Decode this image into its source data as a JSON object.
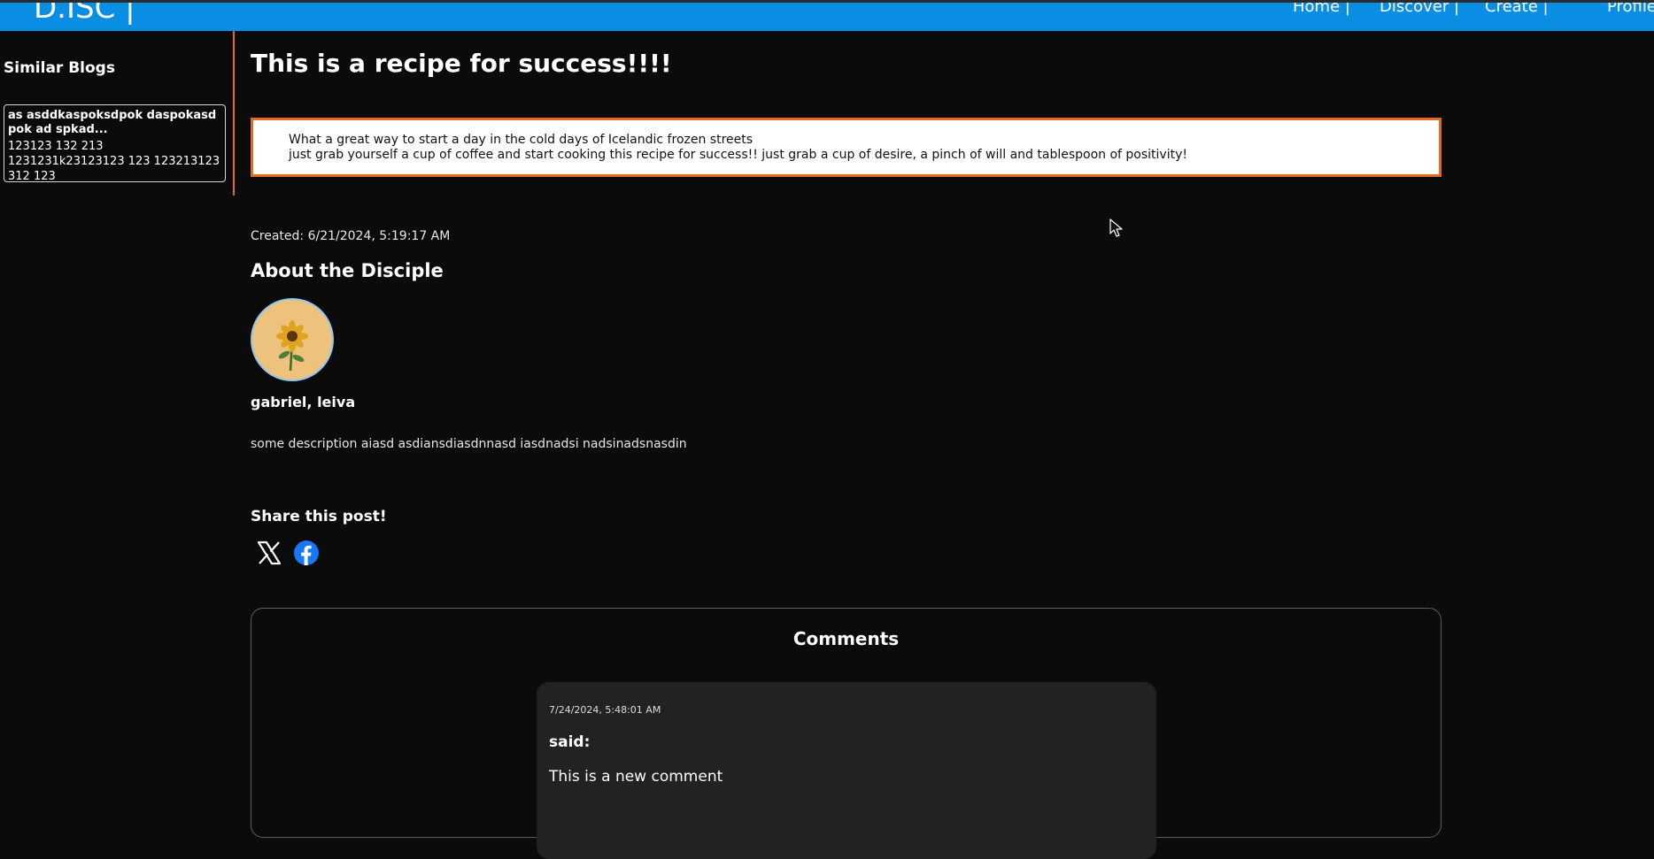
{
  "brand": "D.ISC |",
  "nav": {
    "home": "Home |",
    "discover": "Discover |",
    "create": "Create |",
    "profile": "Profile"
  },
  "sidebar": {
    "title": "Similar Blogs",
    "blogs": [
      {
        "title": "as asddkaspoksdpok daspokasd pok ad spkad...",
        "excerpt": "123123 132 213 1231231k23123123 123 123213123 312 123"
      }
    ]
  },
  "post": {
    "title": "This is a recipe for success!!!!",
    "body_line1": "What a great way to start a day in the cold days of Icelandic frozen streets",
    "body_line2": "just grab yourself a cup of coffee and start cooking this recipe for success!! just grab a cup of desire, a pinch of will and tablespoon of positivity!",
    "created": "Created: 6/21/2024, 5:19:17 AM"
  },
  "author": {
    "section_title": "About the Disciple",
    "avatar_icon": "sunflower-avatar",
    "name": "gabriel, leiva",
    "description": "some description aiasd asdiansdiasdnnasd iasdnadsi nadsinadsnasdin"
  },
  "share": {
    "title": "Share this post!",
    "icons": [
      "x-twitter-icon",
      "facebook-icon"
    ]
  },
  "comments": {
    "title": "Comments",
    "items": [
      {
        "date": "7/24/2024, 5:48:01 AM",
        "said": "said:",
        "text": "This is a new comment"
      }
    ]
  },
  "colors": {
    "navbar": "#0a8ee3",
    "background": "#0b0b0b",
    "accent_border": "#e56a1e",
    "comment_card": "#222222",
    "facebook_blue": "#1877f2"
  }
}
